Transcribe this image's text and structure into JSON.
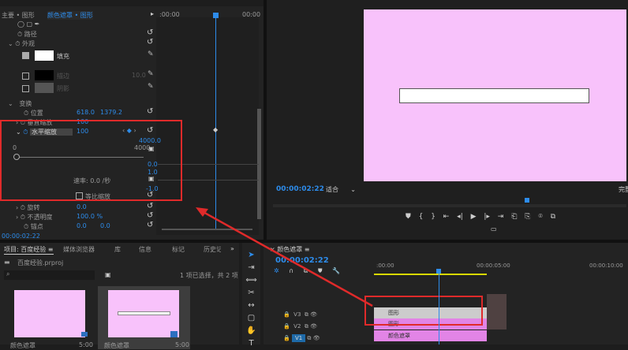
{
  "effect_controls": {
    "tab_master": "主要 • 图形",
    "tab_active": "颜色遮罩 • 图形",
    "path": "路径",
    "appearance": "外观",
    "fill": "填充",
    "stroke": "描边",
    "stroke_width": "10.0",
    "shadow": "阴影",
    "transform": "变换",
    "position": "位置",
    "pos_x": "618.0",
    "pos_y": "1379.2",
    "vscale": "垂直缩放",
    "vscale_val": "100",
    "hscale": "水平缩放",
    "hscale_val": "100",
    "max_val": "4000.0",
    "min_label": "0",
    "max_label": "4000",
    "g0": "0.0",
    "g1": "1.0",
    "gm1": "-1.0",
    "rate": "速率: 0.0 /秒",
    "uniform": "等比缩放",
    "rotation": "旋转",
    "rotation_val": "0.0",
    "opacity": "不透明度",
    "opacity_val": "100.0 %",
    "anchor": "锚点",
    "anchor_x": "0.0",
    "anchor_y": "0.0",
    "timecode": "00:00:02:22",
    "ruler_start": ":00:00",
    "ruler_end": "00:00"
  },
  "program": {
    "timecode": "00:00:02:22",
    "fit": "适合",
    "quality": "完整"
  },
  "project": {
    "tabs": [
      "项目: 百度经验",
      "媒体浏览器",
      "库",
      "信息",
      "标记",
      "历史记录"
    ],
    "file": "百度经验.prproj",
    "selection": "1 项已选择，共 2 项",
    "items": [
      {
        "name": "颜色遮罩",
        "dur": "5:00"
      },
      {
        "name": "颜色遮罩",
        "dur": "5:00"
      }
    ]
  },
  "timeline": {
    "title": "颜色遮罩",
    "timecode": "00:00:02:22",
    "ticks": [
      ":00:00",
      "00:00:05:00",
      "00:00:10:00"
    ],
    "tracks": [
      "V3",
      "V2",
      "V1"
    ],
    "clips": [
      "图形",
      "图形",
      "颜色遮罩"
    ]
  },
  "colors": {
    "accent": "#2d8ceb",
    "matte": "#f8c2fb",
    "highlight": "#e02a2a"
  }
}
